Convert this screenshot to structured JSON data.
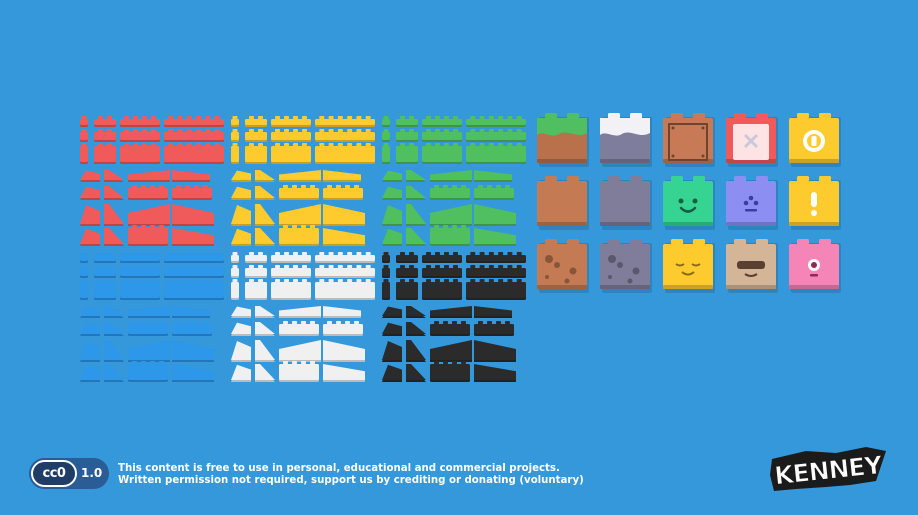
{
  "colors": {
    "background": "#3498db",
    "red": "#f15a5b",
    "yellow": "#fecb2f",
    "green": "#4fbf5f",
    "blue": "#2d97ea",
    "white": "#f0f0f0",
    "black": "#2b2b2b"
  },
  "brick_sets": [
    {
      "name": "red-bricks",
      "color": "red"
    },
    {
      "name": "yellow-bricks",
      "color": "yellow"
    },
    {
      "name": "green-bricks",
      "color": "green"
    },
    {
      "name": "blue-bricks",
      "color": "blue"
    },
    {
      "name": "white-bricks",
      "color": "white"
    },
    {
      "name": "black-bricks",
      "color": "black"
    }
  ],
  "tiles": [
    {
      "name": "grass-block",
      "color": "#b8714b",
      "top": "#4fbf5f",
      "decor": "grass"
    },
    {
      "name": "snow-block",
      "color": "#7f7d9c",
      "top": "#f1f1f6",
      "decor": "snow"
    },
    {
      "name": "crate-block",
      "color": "#c87a57",
      "decor": "crate"
    },
    {
      "name": "x-block",
      "color": "#f15a5b",
      "decor": "x"
    },
    {
      "name": "coin-block",
      "color": "#fecb2f",
      "decor": "coin"
    },
    {
      "name": "dirt-block",
      "color": "#c47a52",
      "decor": "plain"
    },
    {
      "name": "stone-block",
      "color": "#807d9a",
      "decor": "plain"
    },
    {
      "name": "smile-face-block",
      "color": "#35d492",
      "decor": "smile"
    },
    {
      "name": "dots-face-block",
      "color": "#8c8ef2",
      "decor": "dots"
    },
    {
      "name": "exclaim-block",
      "color": "#fecb2f",
      "decor": "exclaim"
    },
    {
      "name": "dirt-rocks-block",
      "color": "#c47a52",
      "decor": "rocks"
    },
    {
      "name": "stone-rocks-block",
      "color": "#807d9a",
      "decor": "rocks"
    },
    {
      "name": "sleepy-face-block",
      "color": "#fecb2f",
      "decor": "sleepy"
    },
    {
      "name": "sunglasses-face-block",
      "color": "#d5b597",
      "decor": "sunglasses"
    },
    {
      "name": "cyclops-face-block",
      "color": "#f585b7",
      "decor": "cyclops"
    }
  ],
  "license": {
    "badge": "cc0",
    "version": "1.0",
    "line1": "This content is free to use in personal, educational and commercial projects.",
    "line2": "Written permission not required, support us by crediting or donating (voluntary)"
  },
  "brand": {
    "logo": "KENNEY"
  }
}
